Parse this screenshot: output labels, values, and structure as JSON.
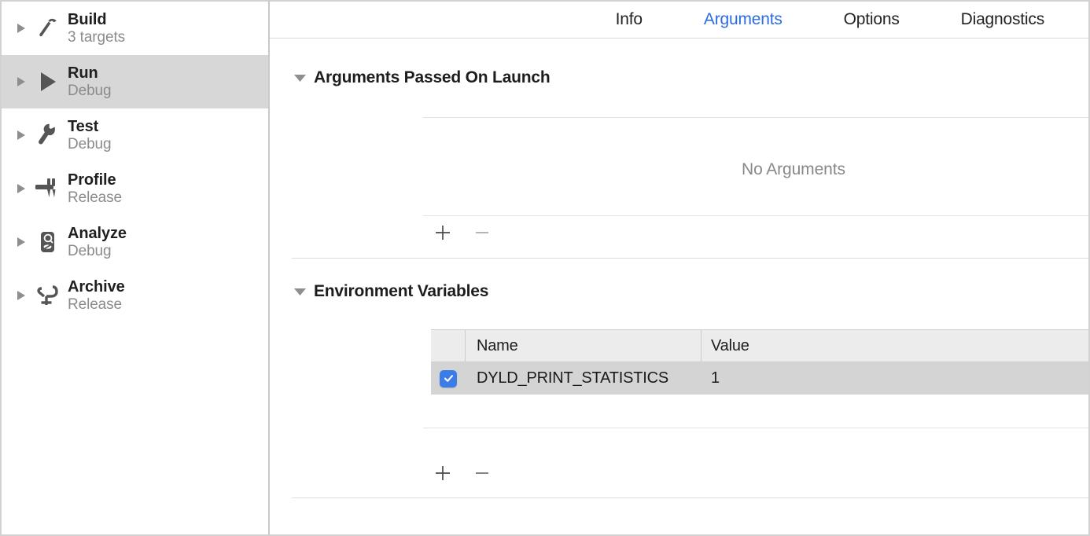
{
  "sidebar": {
    "items": [
      {
        "title": "Build",
        "subtitle": "3 targets",
        "icon": "hammer-icon",
        "selected": false
      },
      {
        "title": "Run",
        "subtitle": "Debug",
        "icon": "play-icon",
        "selected": true
      },
      {
        "title": "Test",
        "subtitle": "Debug",
        "icon": "wrench-icon",
        "selected": false
      },
      {
        "title": "Profile",
        "subtitle": "Release",
        "icon": "caliper-icon",
        "selected": false
      },
      {
        "title": "Analyze",
        "subtitle": "Debug",
        "icon": "analyze-icon",
        "selected": false
      },
      {
        "title": "Archive",
        "subtitle": "Release",
        "icon": "clamp-icon",
        "selected": false
      }
    ]
  },
  "tabs": [
    {
      "label": "Info",
      "active": false
    },
    {
      "label": "Arguments",
      "active": true
    },
    {
      "label": "Options",
      "active": false
    },
    {
      "label": "Diagnostics",
      "active": false
    }
  ],
  "sections": {
    "arguments": {
      "title": "Arguments Passed On Launch",
      "expanded": true,
      "empty_label": "No Arguments",
      "add_label": "+",
      "remove_label": "−"
    },
    "environment": {
      "title": "Environment Variables",
      "expanded": true,
      "columns": [
        "Name",
        "Value"
      ],
      "rows": [
        {
          "checked": true,
          "name": "DYLD_PRINT_STATISTICS",
          "value": "1",
          "selected": true
        }
      ],
      "add_label": "+",
      "remove_label": "−"
    }
  },
  "colors": {
    "accent": "#2b6ce0",
    "checkbox": "#3b7de8",
    "selected_row": "#d4d4d4",
    "selected_sidebar_row": "#d7d7d7",
    "header_bg": "#ececec",
    "muted_text": "#8b8b8b"
  }
}
